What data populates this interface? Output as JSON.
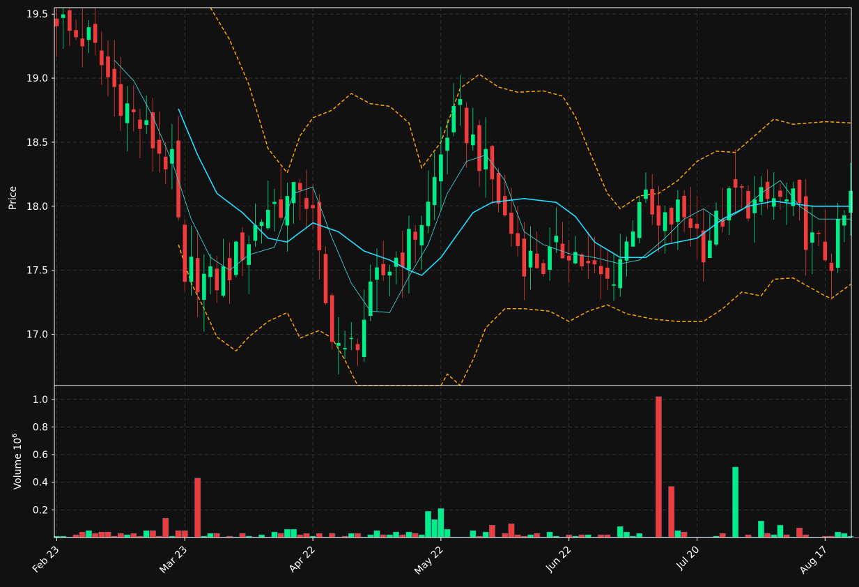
{
  "chart_data": [
    {
      "type": "candlestick",
      "ylabel": "Price",
      "ylim": [
        16.6,
        19.55
      ],
      "yticks": [
        17.0,
        17.5,
        18.0,
        18.5,
        19.0,
        19.5
      ],
      "xtick_labels": [
        "Feb 23",
        "Mar 23",
        "Apr 22",
        "May 22",
        "Jun 22",
        "Jul 20",
        "Aug 17"
      ],
      "xtick_index": [
        0,
        20,
        40,
        60,
        80,
        100,
        120
      ],
      "x_count": 125,
      "grid": true,
      "colors": {
        "up": "#00ee88",
        "down": "#ee3b3b",
        "ma_fast": "#22ddff",
        "ma_slow": "#3ecfcf",
        "bands": "#ffa500",
        "grid": "#3a3a3a",
        "frame": "#ffffff",
        "background": "#111111",
        "text": "#ffffff"
      },
      "candle_keypoints": [
        [
          0,
          19.5
        ],
        [
          2,
          19.35
        ],
        [
          5,
          19.3
        ],
        [
          8,
          19.0
        ],
        [
          12,
          18.7
        ],
        [
          15,
          18.5
        ],
        [
          18,
          18.3
        ],
        [
          19,
          17.85
        ],
        [
          20,
          17.3
        ],
        [
          21,
          17.5
        ],
        [
          24,
          17.4
        ],
        [
          26,
          17.45
        ],
        [
          28,
          17.6
        ],
        [
          30,
          17.75
        ],
        [
          33,
          18.0
        ],
        [
          37,
          18.05
        ],
        [
          38,
          18.2
        ],
        [
          40,
          17.9
        ],
        [
          42,
          17.2
        ],
        [
          45,
          16.8
        ],
        [
          47,
          17.0
        ],
        [
          50,
          17.4
        ],
        [
          53,
          17.6
        ],
        [
          55,
          17.7
        ],
        [
          58,
          18.0
        ],
        [
          61,
          18.6
        ],
        [
          63,
          18.7
        ],
        [
          65,
          18.5
        ],
        [
          68,
          18.2
        ],
        [
          70,
          17.9
        ],
        [
          73,
          17.6
        ],
        [
          76,
          17.55
        ],
        [
          80,
          17.7
        ],
        [
          83,
          17.5
        ],
        [
          86,
          17.4
        ],
        [
          89,
          17.7
        ],
        [
          91,
          18.1
        ],
        [
          94,
          17.8
        ],
        [
          97,
          17.95
        ],
        [
          99,
          17.9
        ],
        [
          101,
          17.7
        ],
        [
          103,
          17.85
        ],
        [
          106,
          18.1
        ],
        [
          109,
          18.0
        ],
        [
          112,
          18.05
        ],
        [
          115,
          18.0
        ],
        [
          118,
          17.7
        ],
        [
          121,
          17.6
        ],
        [
          124,
          18.05
        ]
      ],
      "ma_fast_keypoints": [
        [
          19,
          18.76
        ],
        [
          22,
          18.4
        ],
        [
          25,
          18.1
        ],
        [
          29,
          17.95
        ],
        [
          33,
          17.75
        ],
        [
          36,
          17.72
        ],
        [
          40,
          17.87
        ],
        [
          44,
          17.8
        ],
        [
          48,
          17.65
        ],
        [
          52,
          17.58
        ],
        [
          55,
          17.5
        ],
        [
          57,
          17.46
        ],
        [
          60,
          17.6
        ],
        [
          65,
          17.95
        ],
        [
          68,
          18.03
        ],
        [
          73,
          18.06
        ],
        [
          78,
          18.03
        ],
        [
          81,
          17.92
        ],
        [
          84,
          17.72
        ],
        [
          88,
          17.6
        ],
        [
          92,
          17.6
        ],
        [
          95,
          17.7
        ],
        [
          100,
          17.75
        ],
        [
          104,
          17.9
        ],
        [
          108,
          18.0
        ],
        [
          112,
          18.04
        ],
        [
          118,
          18.0
        ],
        [
          121,
          18.0
        ],
        [
          124,
          18.0
        ]
      ],
      "ma_slow_keypoints": [
        [
          9,
          19.14
        ],
        [
          12,
          18.98
        ],
        [
          15,
          18.7
        ],
        [
          18,
          18.35
        ],
        [
          21,
          17.9
        ],
        [
          24,
          17.6
        ],
        [
          27,
          17.5
        ],
        [
          30,
          17.62
        ],
        [
          34,
          17.68
        ],
        [
          37,
          18.1
        ],
        [
          40,
          18.15
        ],
        [
          43,
          17.75
        ],
        [
          46,
          17.4
        ],
        [
          49,
          17.18
        ],
        [
          52,
          17.17
        ],
        [
          55,
          17.45
        ],
        [
          58,
          17.7
        ],
        [
          61,
          18.1
        ],
        [
          64,
          18.35
        ],
        [
          67,
          18.4
        ],
        [
          70,
          18.2
        ],
        [
          73,
          17.8
        ],
        [
          76,
          17.7
        ],
        [
          80,
          17.63
        ],
        [
          84,
          17.6
        ],
        [
          88,
          17.55
        ],
        [
          91,
          17.58
        ],
        [
          95,
          17.75
        ],
        [
          98,
          17.9
        ],
        [
          101,
          17.98
        ],
        [
          104,
          17.88
        ],
        [
          107,
          17.97
        ],
        [
          110,
          18.1
        ],
        [
          113,
          18.2
        ],
        [
          116,
          18.0
        ],
        [
          119,
          17.9
        ],
        [
          124,
          17.9
        ]
      ],
      "upper_band_keypoints": [
        [
          24,
          19.55
        ],
        [
          27,
          19.3
        ],
        [
          30,
          18.95
        ],
        [
          33,
          18.45
        ],
        [
          36,
          18.26
        ],
        [
          38,
          18.55
        ],
        [
          40,
          18.69
        ],
        [
          43,
          18.75
        ],
        [
          46,
          18.88
        ],
        [
          49,
          18.8
        ],
        [
          52,
          18.78
        ],
        [
          55,
          18.65
        ],
        [
          57,
          18.3
        ],
        [
          60,
          18.5
        ],
        [
          63,
          18.92
        ],
        [
          66,
          19.03
        ],
        [
          69,
          18.93
        ],
        [
          72,
          18.89
        ],
        [
          76,
          18.9
        ],
        [
          79,
          18.86
        ],
        [
          81,
          18.7
        ],
        [
          83,
          18.45
        ],
        [
          86,
          18.1
        ],
        [
          88,
          17.98
        ],
        [
          91,
          18.08
        ],
        [
          94,
          18.1
        ],
        [
          97,
          18.2
        ],
        [
          100,
          18.35
        ],
        [
          103,
          18.43
        ],
        [
          106,
          18.42
        ],
        [
          109,
          18.55
        ],
        [
          112,
          18.68
        ],
        [
          115,
          18.64
        ],
        [
          120,
          18.66
        ],
        [
          124,
          18.65
        ]
      ],
      "lower_band_keypoints": [
        [
          19,
          17.7
        ],
        [
          21,
          17.4
        ],
        [
          23,
          17.2
        ],
        [
          25,
          16.98
        ],
        [
          28,
          16.87
        ],
        [
          30,
          16.98
        ],
        [
          33,
          17.1
        ],
        [
          36,
          17.17
        ],
        [
          38,
          16.97
        ],
        [
          41,
          17.03
        ],
        [
          43,
          16.97
        ],
        [
          45,
          16.8
        ],
        [
          47,
          16.6
        ],
        [
          60,
          16.6
        ],
        [
          61,
          16.69
        ],
        [
          63,
          16.6
        ],
        [
          65,
          16.8
        ],
        [
          67,
          17.05
        ],
        [
          70,
          17.2
        ],
        [
          73,
          17.2
        ],
        [
          77,
          17.18
        ],
        [
          80,
          17.1
        ],
        [
          83,
          17.18
        ],
        [
          86,
          17.23
        ],
        [
          89,
          17.16
        ],
        [
          93,
          17.12
        ],
        [
          97,
          17.1
        ],
        [
          101,
          17.1
        ],
        [
          104,
          17.2
        ],
        [
          107,
          17.33
        ],
        [
          110,
          17.3
        ],
        [
          112,
          17.43
        ],
        [
          115,
          17.44
        ],
        [
          120,
          17.3
        ],
        [
          121,
          17.28
        ],
        [
          124,
          17.39
        ]
      ]
    },
    {
      "type": "bar",
      "ylabel": "Volume  10",
      "ylabel_exponent": "6",
      "ylim": [
        0,
        1.1
      ],
      "yticks": [
        0.2,
        0.4,
        0.6,
        0.8,
        1.0
      ],
      "ytick_labels": [
        "0.2",
        "0.4",
        "0.6",
        "0.8",
        "1.0"
      ],
      "values": [
        0.01,
        0.01,
        0.0,
        0.02,
        0.04,
        0.05,
        0.03,
        0.04,
        0.04,
        0.01,
        0.03,
        0.02,
        0.03,
        0.01,
        0.05,
        0.05,
        0.01,
        0.14,
        0.01,
        0.05,
        0.05,
        0.0,
        0.43,
        0.01,
        0.03,
        0.03,
        0.0,
        0.01,
        0.0,
        0.03,
        0.01,
        0.0,
        0.02,
        0.0,
        0.04,
        0.03,
        0.06,
        0.06,
        0.02,
        0.03,
        0.01,
        0.03,
        0.0,
        0.03,
        0.0,
        0.01,
        0.03,
        0.03,
        0.0,
        0.02,
        0.05,
        0.02,
        0.02,
        0.04,
        0.02,
        0.04,
        0.03,
        0.02,
        0.19,
        0.13,
        0.21,
        0.06,
        0.0,
        0.0,
        0.0,
        0.05,
        0.01,
        0.04,
        0.09,
        0.0,
        0.03,
        0.1,
        0.02,
        0.01,
        0.02,
        0.03,
        0.0,
        0.04,
        0.01,
        0.0,
        0.02,
        0.01,
        0.02,
        0.02,
        0.0,
        0.02,
        0.02,
        0.0,
        0.08,
        0.04,
        0.01,
        0.03,
        0.0,
        0.0,
        1.02,
        0.0,
        0.37,
        0.05,
        0.04,
        0.0,
        0.0,
        0.0,
        0.0,
        0.01,
        0.03,
        0.0,
        0.51,
        0.0,
        0.02,
        0.0,
        0.12,
        0.03,
        0.02,
        0.09,
        0.02,
        0.0,
        0.07,
        0.02,
        0.0,
        0.0,
        0.01,
        0.01,
        0.04,
        0.03,
        0.01,
        0.0,
        0.01
      ]
    }
  ]
}
